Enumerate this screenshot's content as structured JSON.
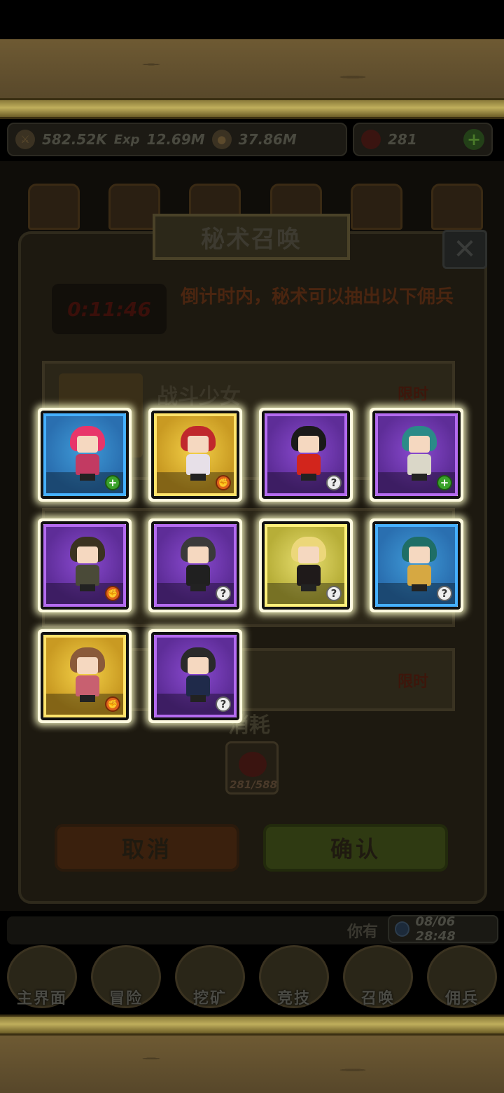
{
  "resources": {
    "attack": "582.52K",
    "exp_label": "Exp",
    "exp": "12.69M",
    "gold": "37.86M",
    "gems": "281"
  },
  "dialog": {
    "title": "秘术召唤",
    "close": "✕",
    "timer": "0:11:46",
    "description": "倒计时内，秘术可以抽出以下佣兵",
    "card1_name": "战斗少女",
    "card1_tag": "限时",
    "card2_tag": "限时",
    "consume_label": "消耗",
    "consume_count": "281/588",
    "cancel": "取消",
    "confirm": "确认"
  },
  "heroes": [
    {
      "rarity": "blue",
      "hair": "#e8356a",
      "body": "#c23a62",
      "badge": "plus",
      "badge_icon": "plus-icon"
    },
    {
      "rarity": "gold",
      "hair": "#c0282c",
      "body": "#e7e0e8",
      "badge": "fist",
      "badge_icon": "fist-icon"
    },
    {
      "rarity": "purple",
      "hair": "#1a1a1a",
      "body": "#d2251c",
      "badge": "question",
      "badge_icon": "question-icon"
    },
    {
      "rarity": "purple",
      "hair": "#2b8a88",
      "body": "#dad7c8",
      "badge": "plus",
      "badge_icon": "plus-icon"
    },
    {
      "rarity": "purple",
      "hair": "#3a3220",
      "body": "#4a4a38",
      "badge": "fist",
      "badge_icon": "fist-icon"
    },
    {
      "rarity": "purple",
      "hair": "#3a3a3a",
      "body": "#202020",
      "badge": "question",
      "badge_icon": "question-icon"
    },
    {
      "rarity": "olive",
      "hair": "#ecd77a",
      "body": "#1f1a1a",
      "badge": "question",
      "badge_icon": "question-icon"
    },
    {
      "rarity": "blue",
      "hair": "#1f6e66",
      "body": "#d6a842",
      "badge": "question",
      "badge_icon": "question-icon"
    },
    {
      "rarity": "gold",
      "hair": "#8a5a3a",
      "body": "#c86070",
      "badge": "fist",
      "badge_icon": "fist-icon"
    },
    {
      "rarity": "purple",
      "hair": "#2a2a2a",
      "body": "#1f2a4a",
      "badge": "question",
      "badge_icon": "question-icon"
    }
  ],
  "status": {
    "you_have": "你有",
    "datetime": "08/06 28:48"
  },
  "nav": [
    {
      "label": "主界面",
      "icon": "map-icon"
    },
    {
      "label": "冒险",
      "icon": "adventure-icon"
    },
    {
      "label": "挖矿",
      "icon": "pickaxe-icon"
    },
    {
      "label": "竞技",
      "icon": "swords-icon"
    },
    {
      "label": "召唤",
      "icon": "scroll-icon"
    },
    {
      "label": "佣兵",
      "icon": "tent-icon"
    }
  ]
}
